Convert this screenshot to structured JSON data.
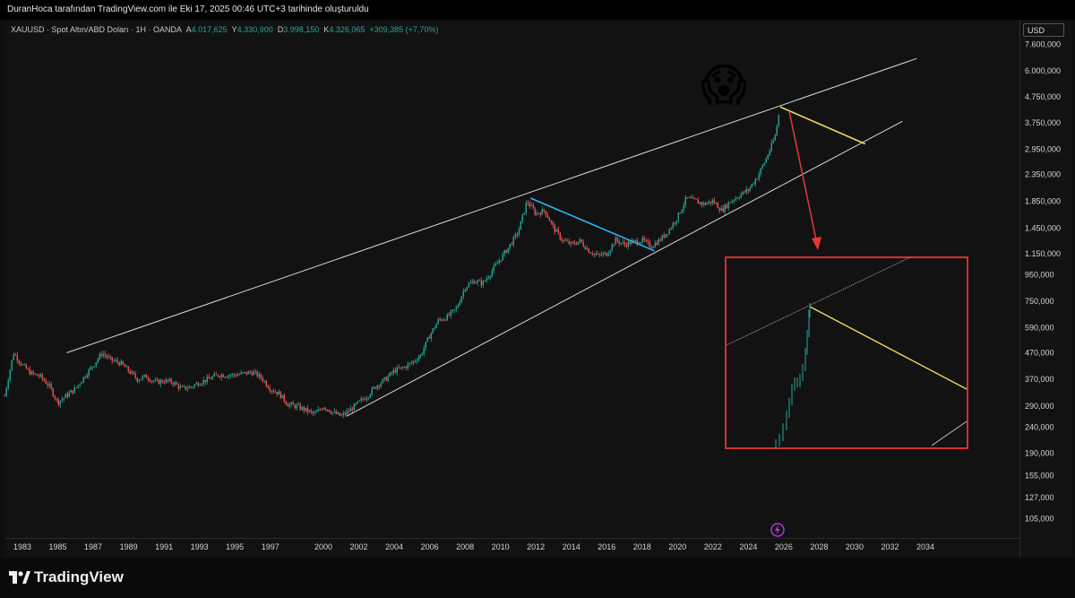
{
  "header": {
    "attribution": "DuranHoca tarafından TradingView.com ile Eki 17, 2025 00:46 UTC+3 tarihinde oluşturuldu"
  },
  "legend": {
    "symbol": "XAUUSD · Spot Altın/ABD Doları · 1H · OANDA",
    "open_label": "A",
    "open_value": "4.017,625",
    "high_label": "Y",
    "high_value": "4.330,900",
    "low_label": "D",
    "low_value": "3.998,150",
    "close_label": "K",
    "close_value": "4.326,065",
    "change": "+309,385 (+7,70%)"
  },
  "price_axis": {
    "currency": "USD",
    "labels": [
      "7.600,000",
      "6.000,000",
      "4.750,000",
      "3.750,000",
      "2.950,000",
      "2.350,000",
      "1.850,000",
      "1.450,000",
      "1.150,000",
      "950,000",
      "750,000",
      "590,000",
      "470,000",
      "370,000",
      "290,000",
      "240,000",
      "190,000",
      "155,000",
      "127,000",
      "105,000"
    ]
  },
  "time_axis": {
    "labels": [
      "1983",
      "1985",
      "1987",
      "1989",
      "1991",
      "1993",
      "1995",
      "1997",
      "2000",
      "2002",
      "2004",
      "2006",
      "2008",
      "2010",
      "2012",
      "2014",
      "2016",
      "2018",
      "2020",
      "2022",
      "2024",
      "2026",
      "2028",
      "2030",
      "2032",
      "2034"
    ]
  },
  "annotations": {
    "emoji": "😱",
    "accent_colors": {
      "upper_channel": "#d9d9d9",
      "blue_line": "#29b6f6",
      "yellow_line": "#f0d75a",
      "red_arrow": "#e53935",
      "inset_frame": "#d32f2f",
      "candle_up": "#26a69a",
      "candle_down": "#ef5350"
    },
    "bolt_icon": "lightning-icon"
  },
  "chart_data": {
    "type": "candlestick",
    "title": "XAUUSD · Spot Altın/ABD Doları · 1H · OANDA",
    "scale": "log",
    "y_unit": "USD",
    "ylim": [
      95,
      8000
    ],
    "xlim": [
      1982,
      2036
    ],
    "series": [
      {
        "name": "XAUUSD",
        "x": [
          1982.0,
          1982.5,
          1983.0,
          1983.5,
          1984.0,
          1984.5,
          1985.0,
          1985.5,
          1986.0,
          1986.5,
          1987.0,
          1987.5,
          1988.0,
          1988.5,
          1989.0,
          1989.5,
          1990.0,
          1990.5,
          1991.0,
          1991.5,
          1992.0,
          1992.5,
          1993.0,
          1993.5,
          1994.0,
          1994.5,
          1995.0,
          1995.5,
          1996.0,
          1996.5,
          1997.0,
          1997.5,
          1998.0,
          1998.5,
          1999.0,
          1999.5,
          2000.0,
          2000.5,
          2001.0,
          2001.5,
          2002.0,
          2002.5,
          2003.0,
          2003.5,
          2004.0,
          2004.5,
          2005.0,
          2005.5,
          2006.0,
          2006.5,
          2007.0,
          2007.5,
          2008.0,
          2008.5,
          2009.0,
          2009.5,
          2010.0,
          2010.5,
          2011.0,
          2011.5,
          2012.0,
          2012.5,
          2013.0,
          2013.5,
          2014.0,
          2014.5,
          2015.0,
          2015.5,
          2016.0,
          2016.5,
          2017.0,
          2017.5,
          2018.0,
          2018.5,
          2019.0,
          2019.5,
          2020.0,
          2020.5,
          2021.0,
          2021.5,
          2022.0,
          2022.5,
          2023.0,
          2023.5,
          2024.0,
          2024.5,
          2025.0,
          2025.5,
          2025.8
        ],
        "values": [
          320,
          470,
          420,
          390,
          380,
          350,
          300,
          320,
          340,
          380,
          420,
          470,
          440,
          430,
          400,
          370,
          380,
          360,
          365,
          360,
          340,
          345,
          360,
          370,
          385,
          385,
          385,
          390,
          395,
          375,
          340,
          325,
          295,
          290,
          280,
          270,
          290,
          275,
          265,
          280,
          300,
          320,
          350,
          370,
          400,
          410,
          430,
          460,
          550,
          630,
          650,
          700,
          850,
          900,
          880,
          980,
          1100,
          1230,
          1400,
          1850,
          1650,
          1700,
          1450,
          1300,
          1250,
          1290,
          1180,
          1130,
          1150,
          1300,
          1250,
          1280,
          1300,
          1230,
          1300,
          1420,
          1600,
          1900,
          1850,
          1800,
          1850,
          1700,
          1850,
          1950,
          2050,
          2300,
          2700,
          3300,
          4330
        ]
      }
    ],
    "overlays": [
      {
        "name": "upper-channel",
        "x": [
          1985.5,
          2033.5
        ],
        "y": [
          470,
          6700
        ]
      },
      {
        "name": "lower-channel",
        "x": [
          2001.3,
          2032.7
        ],
        "y": [
          265,
          3800
        ]
      },
      {
        "name": "blue-trendline",
        "x": [
          2011.7,
          2018.7
        ],
        "y": [
          1900,
          1180
        ]
      },
      {
        "name": "yellow-line",
        "x": [
          2025.8,
          2030.6
        ],
        "y": [
          4330,
          3100
        ]
      }
    ]
  }
}
